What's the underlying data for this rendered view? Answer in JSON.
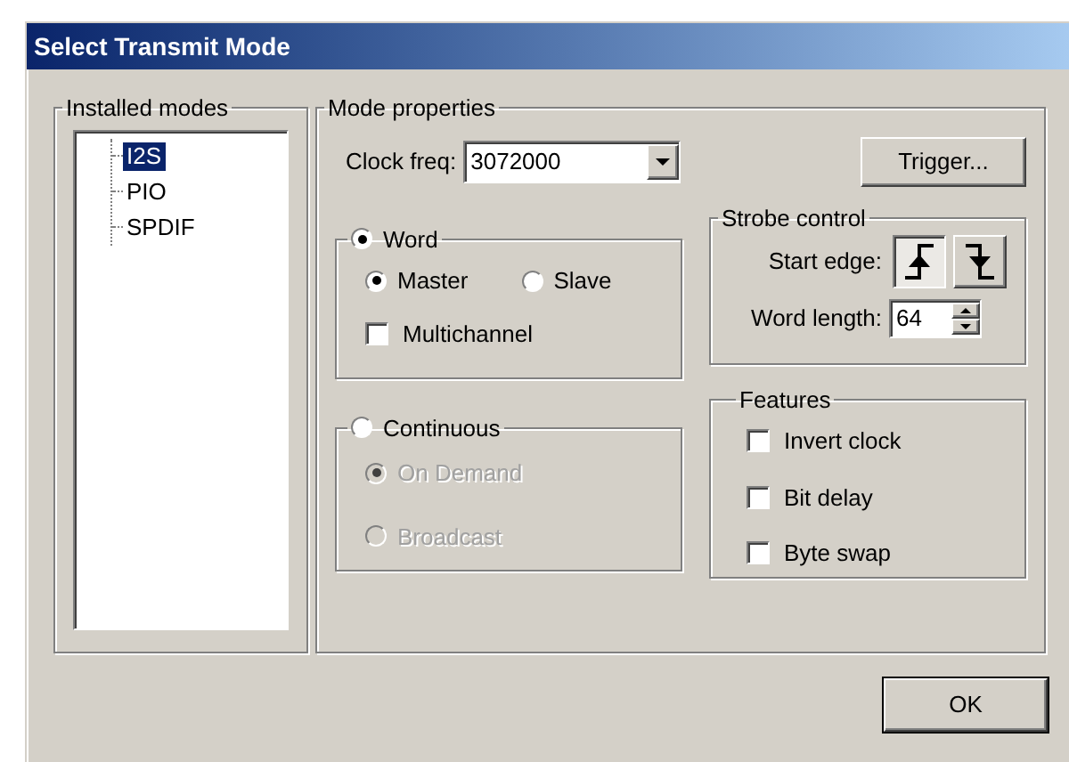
{
  "window": {
    "title": "Select Transmit Mode"
  },
  "installed_modes": {
    "label": "Installed modes",
    "items": [
      {
        "label": "I2S",
        "selected": true
      },
      {
        "label": "PIO",
        "selected": false
      },
      {
        "label": "SPDIF",
        "selected": false
      }
    ]
  },
  "mode_properties": {
    "label": "Mode properties",
    "clock_freq": {
      "label": "Clock freq:",
      "value": "3072000"
    },
    "trigger_button": "Trigger...",
    "word": {
      "label": "Word",
      "selected": true,
      "options": [
        {
          "label": "Master",
          "selected": true
        },
        {
          "label": "Slave",
          "selected": false
        }
      ],
      "multichannel": {
        "label": "Multichannel",
        "checked": false
      }
    },
    "continuous": {
      "label": "Continuous",
      "selected": false,
      "options": [
        {
          "label": "On Demand",
          "selected": true,
          "disabled": true
        },
        {
          "label": "Broadcast",
          "selected": false,
          "disabled": true
        }
      ]
    },
    "strobe_control": {
      "label": "Strobe control",
      "start_edge": {
        "label": "Start edge:",
        "options": [
          {
            "kind": "rising",
            "selected": true
          },
          {
            "kind": "falling",
            "selected": false
          }
        ]
      },
      "word_length": {
        "label": "Word length:",
        "value": "64"
      }
    },
    "features": {
      "label": "Features",
      "items": [
        {
          "label": "Invert clock",
          "checked": false
        },
        {
          "label": "Bit delay",
          "checked": false
        },
        {
          "label": "Byte swap",
          "checked": false
        }
      ]
    }
  },
  "buttons": [
    "OK"
  ]
}
